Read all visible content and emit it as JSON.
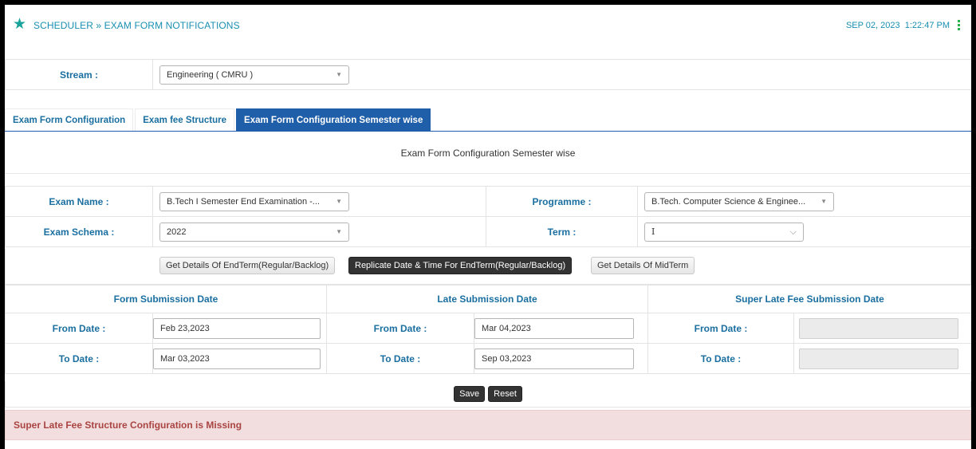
{
  "header": {
    "breadcrumb": "SCHEDULER » EXAM FORM NOTIFICATIONS",
    "datetime": "SEP 02, 2023  1:22:47 PM"
  },
  "stream": {
    "label": "Stream :",
    "value": "Engineering ( CMRU )"
  },
  "tabs": [
    {
      "label": "Exam Form Configuration",
      "active": false
    },
    {
      "label": "Exam fee Structure",
      "active": false
    },
    {
      "label": "Exam Form Configuration Semester wise",
      "active": true
    }
  ],
  "panel_title": "Exam Form Configuration Semester wise",
  "exam": {
    "exam_name_label": "Exam Name :",
    "exam_name_value": "B.Tech I Semester End Examination -...",
    "programme_label": "Programme :",
    "programme_value": "B.Tech. Computer Science & Enginee...",
    "schema_label": "Exam Schema :",
    "schema_value": "2022",
    "term_label": "Term :",
    "term_value": "I"
  },
  "buttons": {
    "get_endterm": "Get Details Of EndTerm(Regular/Backlog)",
    "replicate": "Replicate Date & Time For EndTerm(Regular/Backlog)",
    "get_midterm": "Get Details Of MidTerm"
  },
  "dates": {
    "form_header": "Form Submission Date",
    "late_header": "Late Submission Date",
    "super_header": "Super Late Fee Submission Date",
    "from_label": "From Date :",
    "to_label": "To Date :",
    "form_from": "Feb 23,2023",
    "form_to": "Mar 03,2023",
    "late_from": "Mar 04,2023",
    "late_to": "Sep 03,2023",
    "super_from": "",
    "super_to": ""
  },
  "actions": {
    "save": "Save",
    "reset": "Reset"
  },
  "alert": "Super Late Fee Structure Configuration is Missing",
  "colors": {
    "accent": "#1a6fa0",
    "tab_active": "#1f5ea8",
    "alert_bg": "#f2dede",
    "alert_text": "#a94442"
  }
}
